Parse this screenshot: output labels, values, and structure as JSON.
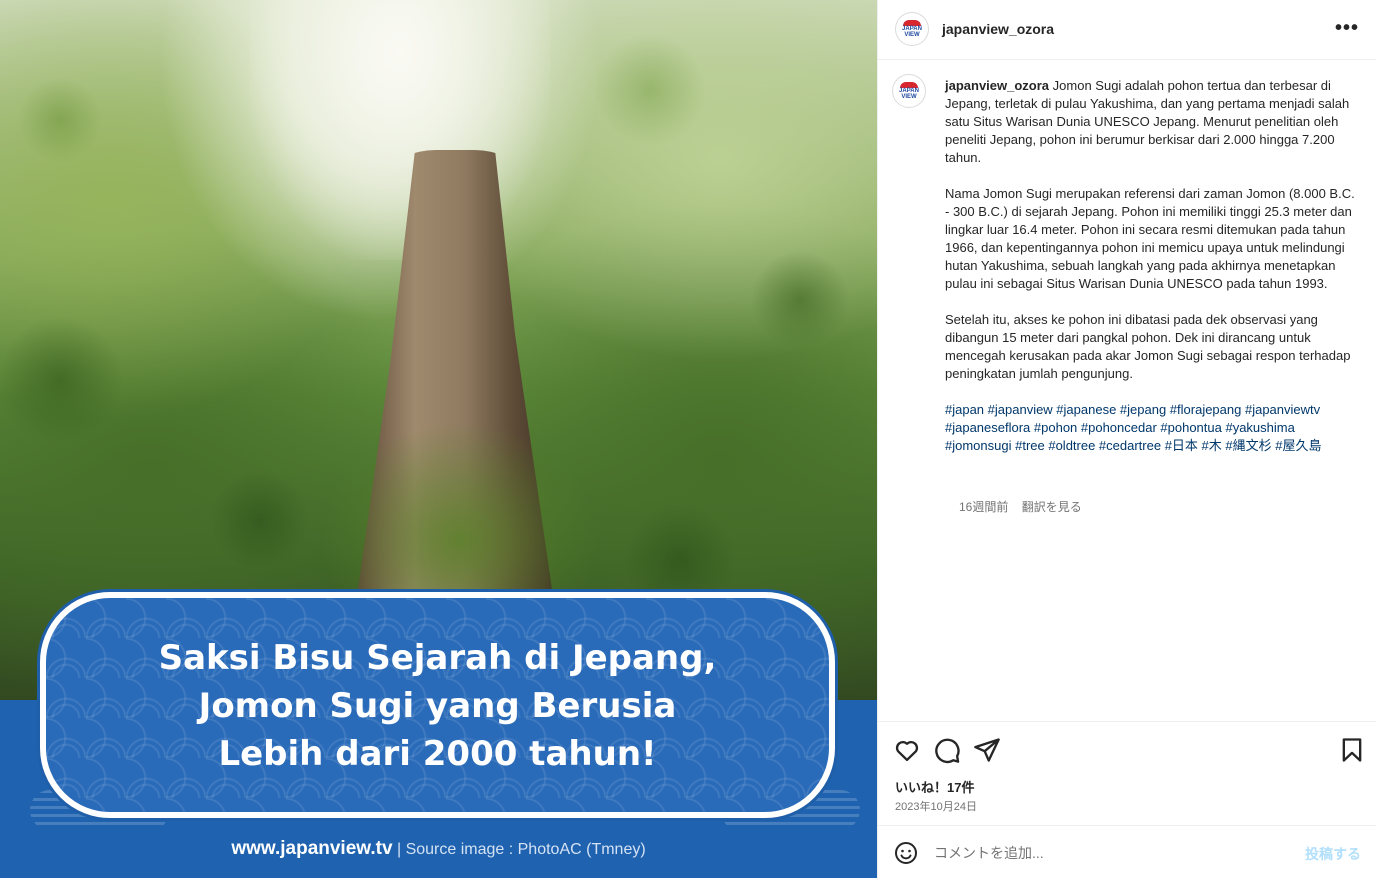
{
  "media": {
    "banner_title": "Saksi Bisu Sejarah di Jepang,\nJomon Sugi yang Berusia\nLebih dari 2000 tahun!",
    "site": "www.japanview.tv",
    "separator": " | ",
    "source": "Source image : PhotoAC (Tmney)",
    "colors": {
      "band": "#1f63b0",
      "banner": "#2a6bb9"
    }
  },
  "header": {
    "username": "japanview_ozora",
    "more_icon": "more-horizontal-icon",
    "avatar_text": "JAPAN VIEW"
  },
  "caption": {
    "username": "japanview_ozora",
    "paragraphs": [
      "Jomon Sugi adalah pohon tertua dan terbesar di Jepang, terletak di pulau Yakushima, dan yang pertama menjadi salah satu Situs Warisan Dunia UNESCO Jepang. Menurut penelitian oleh peneliti Jepang, pohon ini berumur berkisar dari 2.000 hingga 7.200 tahun.",
      "Nama Jomon Sugi merupakan referensi dari zaman Jomon (8.000 B.C. - 300 B.C.) di sejarah Jepang. Pohon ini memiliki tinggi 25.3 meter dan lingkar luar 16.4 meter. Pohon ini secara resmi ditemukan pada tahun 1966, dan kepentingannya pohon ini memicu upaya untuk melindungi hutan Yakushima, sebuah langkah yang pada akhirnya menetapkan pulau ini sebagai Situs Warisan Dunia UNESCO pada tahun 1993.",
      "Setelah itu, akses ke pohon ini dibatasi pada dek observasi yang dibangun 15 meter dari pangkal pohon. Dek ini dirancang untuk mencegah kerusakan pada akar Jomon Sugi sebagai respon terhadap peningkatan jumlah pengunjung."
    ],
    "hashtags": "#japan #japanview #japanese #jepang #florajepang #japanviewtv #japaneseflora #pohon #pohoncedar #pohontua #yakushima #jomonsugi #tree #oldtree #cedartree #日本 #木 #縄文杉 #屋久島",
    "time_ago": "16週間前",
    "translate": "翻訳を見る"
  },
  "actions": {
    "icons": [
      "heart-icon",
      "comment-icon",
      "share-icon",
      "bookmark-icon"
    ],
    "likes": "いいね！17件",
    "date": "2023年10月24日"
  },
  "comment": {
    "emoji_icon": "emoji-icon",
    "placeholder": "コメントを追加...",
    "post_label": "投稿する"
  }
}
